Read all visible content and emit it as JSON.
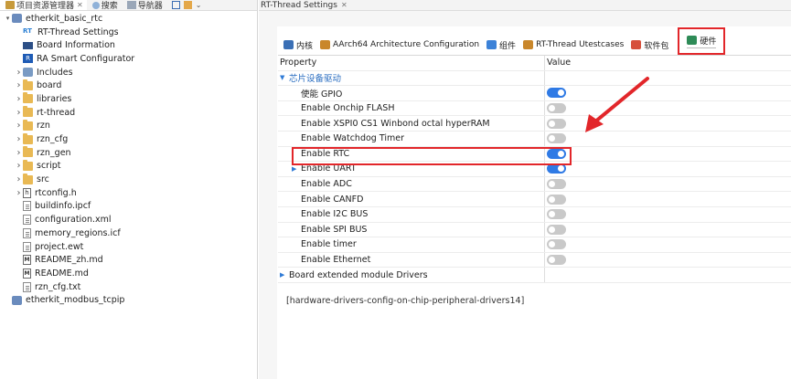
{
  "left_tabs": [
    {
      "label": "项目资源管理器",
      "icon": "project-explorer-icon",
      "active": true
    },
    {
      "label": "搜索",
      "icon": "search-icon"
    },
    {
      "label": "导航器",
      "icon": "navigator-icon"
    }
  ],
  "tree": [
    {
      "label": "etherkit_basic_rtc",
      "icon": "project",
      "expanded": true,
      "level": 0
    },
    {
      "label": "RT-Thread Settings",
      "icon": "rt",
      "level": 1
    },
    {
      "label": "Board Information",
      "icon": "board",
      "level": 1
    },
    {
      "label": "RA Smart Configurator",
      "icon": "ra",
      "level": 1
    },
    {
      "label": "Includes",
      "icon": "include",
      "expandable": true,
      "level": 1
    },
    {
      "label": "board",
      "icon": "folder",
      "expandable": true,
      "level": 1
    },
    {
      "label": "libraries",
      "icon": "folder",
      "expandable": true,
      "level": 1
    },
    {
      "label": "rt-thread",
      "icon": "folder",
      "expandable": true,
      "level": 1
    },
    {
      "label": "rzn",
      "icon": "folder",
      "expandable": true,
      "level": 1
    },
    {
      "label": "rzn_cfg",
      "icon": "folder",
      "expandable": true,
      "level": 1
    },
    {
      "label": "rzn_gen",
      "icon": "folder",
      "expandable": true,
      "level": 1
    },
    {
      "label": "script",
      "icon": "folder",
      "expandable": true,
      "level": 1
    },
    {
      "label": "src",
      "icon": "folder",
      "expandable": true,
      "level": 1
    },
    {
      "label": "rtconfig.h",
      "icon": "h",
      "expandable": true,
      "level": 1
    },
    {
      "label": "buildinfo.ipcf",
      "icon": "file",
      "level": 1
    },
    {
      "label": "configuration.xml",
      "icon": "file",
      "level": 1
    },
    {
      "label": "memory_regions.icf",
      "icon": "file",
      "level": 1
    },
    {
      "label": "project.ewt",
      "icon": "file",
      "level": 1
    },
    {
      "label": "README_zh.md",
      "icon": "md",
      "level": 1
    },
    {
      "label": "README.md",
      "icon": "md",
      "level": 1
    },
    {
      "label": "rzn_cfg.txt",
      "icon": "file",
      "level": 1
    },
    {
      "label": "etherkit_modbus_tcpip",
      "icon": "project",
      "level": 0
    }
  ],
  "editor_tab": {
    "label": "RT-Thread Settings"
  },
  "settings_tabs": [
    {
      "label": "内核",
      "icon": "kernel-icon",
      "color": "#3a6fb5"
    },
    {
      "label": "AArch64 Architecture Configuration",
      "icon": "aarch64-icon",
      "color": "#c9872b"
    },
    {
      "label": "组件",
      "icon": "component-icon",
      "color": "#3c82d8"
    },
    {
      "label": "RT-Thread Utestcases",
      "icon": "utest-icon",
      "color": "#c9872b"
    },
    {
      "label": "软件包",
      "icon": "package-icon",
      "color": "#d64f3b"
    },
    {
      "label": "硬件",
      "icon": "hardware-icon",
      "color": "#2e8b57",
      "selected": true
    }
  ],
  "grid": {
    "header_property": "Property",
    "header_value": "Value",
    "rows": [
      {
        "label": "芯片设备驱动",
        "type": "group",
        "expanded": true
      },
      {
        "label": "使能 GPIO",
        "on": true
      },
      {
        "label": "Enable Onchip FLASH",
        "on": false
      },
      {
        "label": "Enable XSPI0 CS1 Winbond octal hyperRAM",
        "on": false
      },
      {
        "label": "Enable Watchdog Timer",
        "on": false
      },
      {
        "label": "Enable RTC",
        "on": true,
        "highlight": true
      },
      {
        "label": "Enable UART",
        "on": true,
        "expandable": true
      },
      {
        "label": "Enable ADC",
        "on": false
      },
      {
        "label": "Enable CANFD",
        "on": false
      },
      {
        "label": "Enable I2C BUS",
        "on": false
      },
      {
        "label": "Enable SPI BUS",
        "on": false
      },
      {
        "label": "Enable timer",
        "on": false
      },
      {
        "label": "Enable Ethernet",
        "on": false
      },
      {
        "label": "Board extended module Drivers",
        "type": "group",
        "expanded": false
      }
    ]
  },
  "footer_text": "[hardware-drivers-config-on-chip-peripheral-drivers14]",
  "collapse_glyph": "»",
  "colors": {
    "toggle_on": "#2f7ae5",
    "toggle_off": "#c9c9c9",
    "highlight": "#e2262a"
  }
}
